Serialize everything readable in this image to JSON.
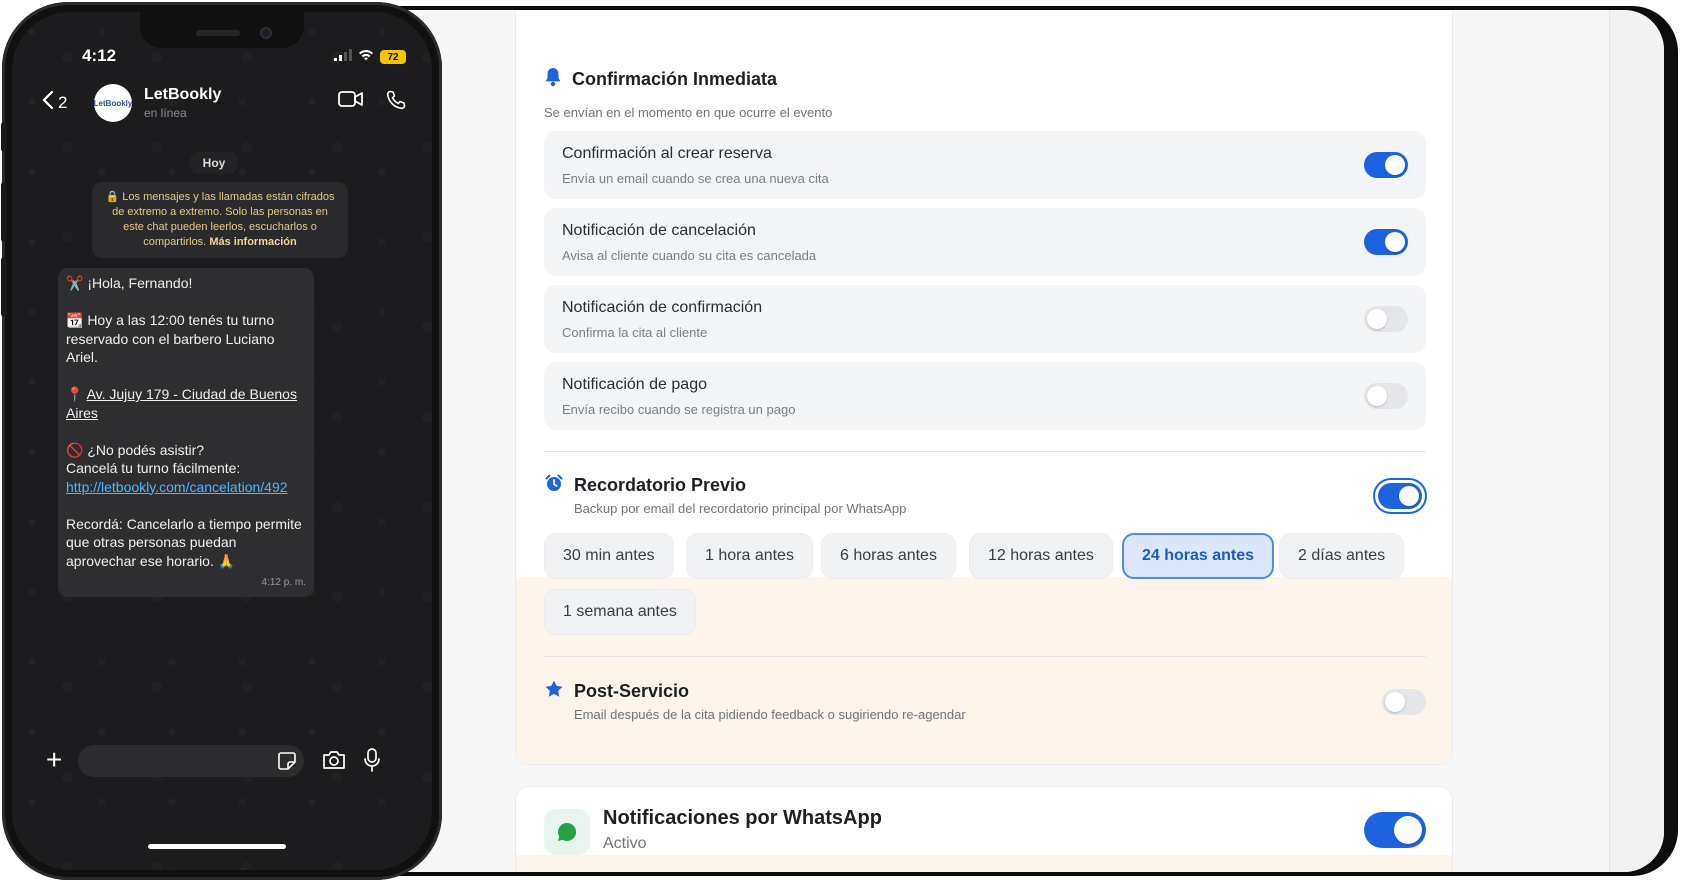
{
  "phone": {
    "status_bar": {
      "time": "4:12",
      "battery": "72"
    },
    "chat_header": {
      "back_count": "2",
      "contact_name": "LetBookly",
      "contact_status": "en línea",
      "avatar_text": "LetBookly"
    },
    "day_label": "Hoy",
    "encryption_notice": {
      "text": "Los mensajes y las llamadas están cifrados de extremo a extremo. Solo las personas en este chat pueden leerlos, escucharlos o compartirlos.",
      "link": "Más información"
    },
    "message": {
      "greeting": "✂️ ¡Hola, Fernando!",
      "appointment": "📆 Hoy a las 12:00 tenés tu turno reservado con el barbero Luciano Ariel.",
      "address_pin": "📍",
      "address": "Av. Jujuy 179 - Ciudad de Buenos Aires",
      "cancel_question": "🚫 ¿No podés asistir?",
      "cancel_text": "Cancelá tu turno fácilmente:",
      "cancel_link": "http://letbookly.com/cancelation/492",
      "reminder": "Recordá: Cancelarlo a tiempo permite que otras personas puedan aprovechar ese horario. 🙏",
      "time": "4:12 p. m."
    }
  },
  "dashboard": {
    "immediate": {
      "title": "Confirmación Inmediata",
      "subtitle": "Se envían en el momento en que ocurre el evento",
      "icon": "bell-icon",
      "rows": [
        {
          "title": "Confirmación al crear reserva",
          "desc": "Envía un email cuando se crea una nueva cita",
          "enabled": true
        },
        {
          "title": "Notificación de cancelación",
          "desc": "Avisa al cliente cuando su cita es cancelada",
          "enabled": true
        },
        {
          "title": "Notificación de confirmación",
          "desc": "Confirma la cita al cliente",
          "enabled": false
        },
        {
          "title": "Notificación de pago",
          "desc": "Envía recibo cuando se registra un pago",
          "enabled": false
        }
      ]
    },
    "reminder": {
      "title": "Recordatorio Previo",
      "subtitle": "Backup por email del recordatorio principal por WhatsApp",
      "icon": "alarm-clock-icon",
      "enabled": true,
      "options": [
        "30 min antes",
        "1 hora antes",
        "6 horas antes",
        "12 horas antes",
        "24 horas antes",
        "2 días antes",
        "1 semana antes"
      ],
      "selected": "24 horas antes"
    },
    "post_service": {
      "title": "Post-Servicio",
      "subtitle": "Email después de la cita pidiendo feedback o sugiriendo re-agendar",
      "icon": "star-icon",
      "enabled": false
    },
    "whatsapp": {
      "title": "Notificaciones por WhatsApp",
      "status": "Activo",
      "icon": "whatsapp-icon",
      "enabled": true
    }
  },
  "colors": {
    "accent": "#1d63e0",
    "whatsapp_green": "#25a244",
    "tint": "#fdf5ec"
  }
}
